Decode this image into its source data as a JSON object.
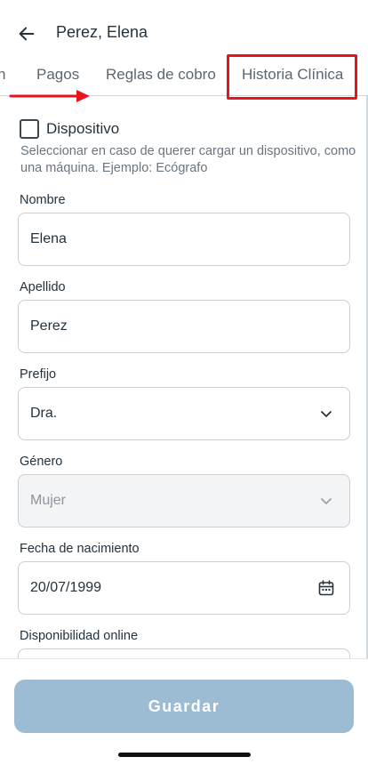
{
  "header": {
    "title": "Perez, Elena"
  },
  "tabs": [
    {
      "label": "n"
    },
    {
      "label": "Pagos"
    },
    {
      "label": "Reglas de cobro"
    },
    {
      "label": "Historia Clínica"
    }
  ],
  "device": {
    "label": "Dispositivo",
    "checked": false,
    "help": "Seleccionar en caso de querer cargar un dispositivo, como una máquina. Ejemplo: Ecógrafo"
  },
  "fields": {
    "nombre": {
      "label": "Nombre",
      "value": "Elena"
    },
    "apellido": {
      "label": "Apellido",
      "value": "Perez"
    },
    "prefijo": {
      "label": "Prefijo",
      "value": "Dra."
    },
    "genero": {
      "label": "Género",
      "value": "Mujer"
    },
    "fecha": {
      "label": "Fecha de nacimiento",
      "value": "20/07/1999"
    },
    "disponibilidad": {
      "label": "Disponibilidad online"
    }
  },
  "footer": {
    "save_label": "Guardar"
  },
  "colors": {
    "annotation": "#e8141c",
    "button": "#9bbcd3"
  }
}
